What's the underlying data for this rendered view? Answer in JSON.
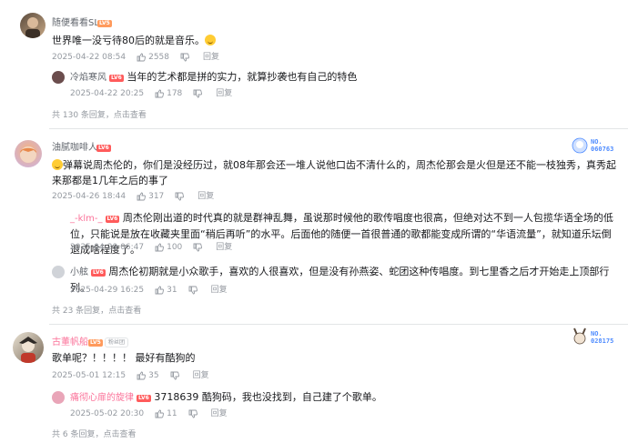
{
  "comments": [
    {
      "user": "随便看看SL",
      "level": "LV5",
      "text": "世界唯一没亏待80后的就是音乐。",
      "date": "2025-04-22 08:54",
      "likes": "2558",
      "reply_label": "回复",
      "replies": [
        {
          "user": "冷焰寒风",
          "level": "LV6",
          "text": "当年的艺术都是拼的实力，就算抄袭也有自己的特色",
          "date": "2025-04-22 20:25",
          "likes": "178",
          "reply_label": "回复"
        }
      ],
      "more_count": "共 130 条回复，",
      "more_link": "点击查看"
    },
    {
      "user": "油腻咖啡人",
      "level": "LV6",
      "badge_no": "NO.",
      "badge_num": "060763",
      "text": "弹幕说周杰伦的，你们是没经历过，就08年那会还一堆人说他口齿不清什么的，周杰伦那会是火但是还不能一枝独秀，真秀起来那都是1几年之后的事了",
      "date": "2025-04-26 18:44",
      "likes": "317",
      "reply_label": "回复",
      "replies": [
        {
          "user": "_-klm-_",
          "level": "LV6",
          "text": "周杰伦刚出道的时代真的就是群神乱舞，虽说那时候他的歌传唱度也很高，但绝对达不到一人包揽华语全场的低位，只能说是放在收藏夹里面“稍后再听”的水平。后面他的随便一首很普通的歌都能变成所谓的“华语流量”，就知道乐坛倒退成啥程度了。",
          "date": "2025-04-29 06:47",
          "likes": "100",
          "reply_label": "回复"
        },
        {
          "user": "小舷",
          "level": "LV6",
          "text": "周杰伦初期就是小众歌手，喜欢的人很喜欢，但是没有孙燕姿、蛇团这种传唱度。到七里香之后才开始走上顶部行列。",
          "date": "2025-04-29 16:25",
          "likes": "31",
          "reply_label": "回复"
        }
      ],
      "more_count": "共 23 条回复，",
      "more_link": "点击查看"
    },
    {
      "user": "古董帆船",
      "level": "LV5",
      "tag": "粉丝团",
      "badge_no": "NO.",
      "badge_num": "028175",
      "text": "歌单呢？！！！！ 最好有酷狗的",
      "date": "2025-05-01 12:15",
      "likes": "35",
      "reply_label": "回复",
      "replies": [
        {
          "user": "痛彻心扉的旋律",
          "level": "LV6",
          "text": "3718639 酷狗码，我也没找到，自己建了个歌单。",
          "date": "2025-05-02 20:30",
          "likes": "11",
          "reply_label": "回复"
        }
      ],
      "more_count": "共 6 条回复，",
      "more_link": "点击查看"
    }
  ],
  "colors": {
    "name_default": "#61666d",
    "name_vip": "#fb7299",
    "meta": "#9499a0",
    "badge": "#4f8cff"
  }
}
